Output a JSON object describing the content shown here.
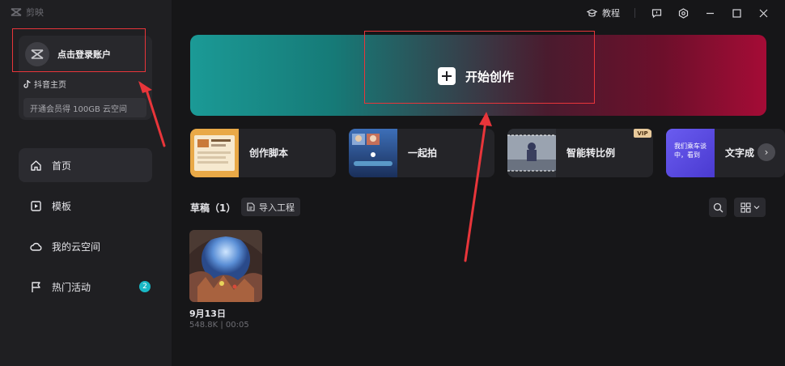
{
  "app": {
    "brand_name": "剪映"
  },
  "sidebar": {
    "login": {
      "label": "点击登录账户"
    },
    "douyin": {
      "label": "抖音主页"
    },
    "vip_promo": {
      "label": "开通会员得 100GB 云空间"
    },
    "nav": [
      {
        "label": "首页",
        "icon": "home-icon",
        "active": true
      },
      {
        "label": "模板",
        "icon": "template-icon"
      },
      {
        "label": "我的云空间",
        "icon": "cloud-icon"
      },
      {
        "label": "热门活动",
        "icon": "flag-icon",
        "badge": "2"
      }
    ]
  },
  "titlebar": {
    "tutorial_label": "教程"
  },
  "hero": {
    "label": "开始创作"
  },
  "tools": [
    {
      "label": "创作脚本"
    },
    {
      "label": "一起拍"
    },
    {
      "label": "智能转比例",
      "tag": "VIP"
    },
    {
      "label": "文字成",
      "thumb_text": "我们乘车谈中，看到"
    }
  ],
  "drafts": {
    "title": "草稿（1）",
    "import_label": "导入工程",
    "items": [
      {
        "date": "9月13日",
        "meta": "548.8K | 00:05"
      }
    ]
  },
  "colors": {
    "accent": "#19b8c6",
    "annotation": "#e8353a",
    "vip": "#e8c99b"
  }
}
